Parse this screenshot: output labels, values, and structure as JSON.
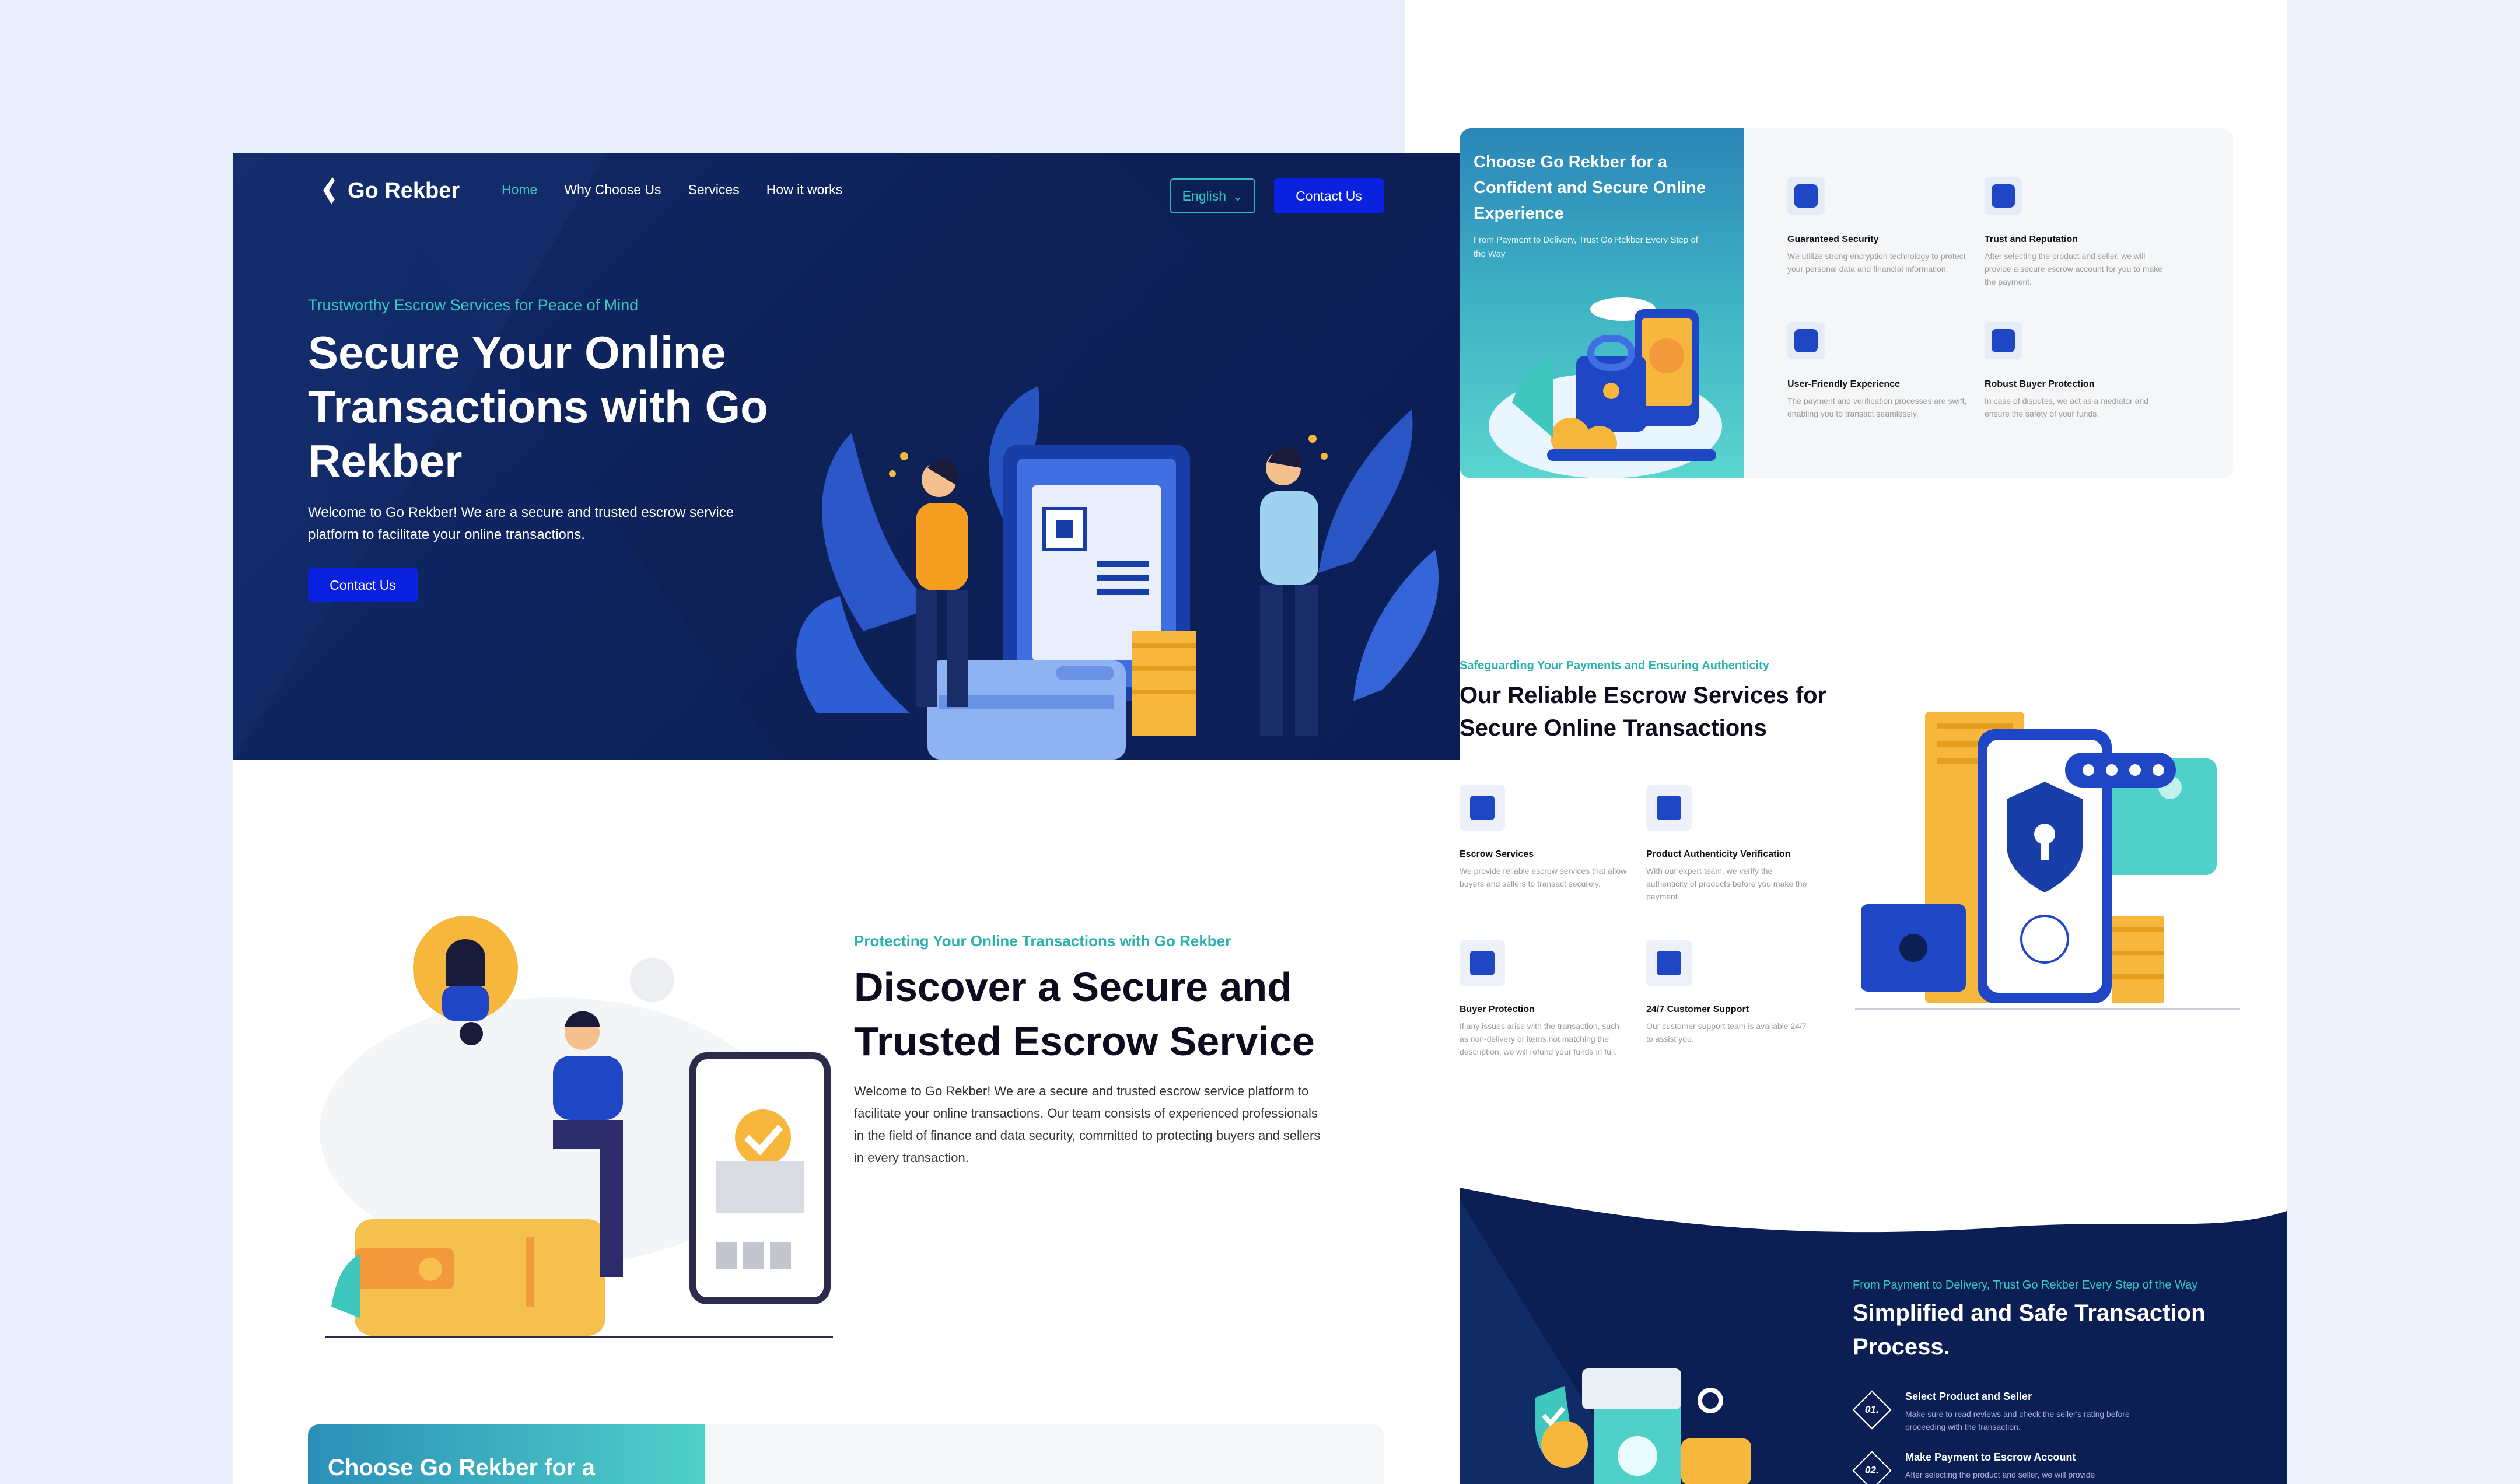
{
  "nav": {
    "brand": "Go Rekber",
    "links": [
      "Home",
      "Why Choose Us",
      "Services",
      "How it works"
    ],
    "language": "English",
    "contact": "Contact Us"
  },
  "hero": {
    "eyebrow": "Trustworthy Escrow Services for Peace of Mind",
    "title": "Secure Your Online Transactions with Go Rekber",
    "description": "Welcome to Go Rekber! We are a secure and trusted escrow service platform to facilitate your online transactions.",
    "cta": "Contact Us"
  },
  "discover": {
    "eyebrow": "Protecting Your Online Transactions with Go Rekber",
    "title": "Discover a Secure and Trusted Escrow Service",
    "description": "Welcome to Go Rekber! We are a secure and trusted escrow service platform to facilitate your online transactions. Our team consists of experienced professionals in the field of finance and data security, committed to protecting buyers and sellers in every transaction."
  },
  "choose_strip": {
    "title": "Choose Go Rekber for a"
  },
  "choose": {
    "title": "Choose Go Rekber for a Confident and Secure Online Experience",
    "subtitle": "From Payment to Delivery, Trust Go Rekber Every Step of the Way",
    "features": [
      {
        "title": "Guaranteed Security",
        "desc": "We utilize strong encryption technology to protect your personal data and financial information.",
        "icon": "shield-icon"
      },
      {
        "title": "Trust and Reputation",
        "desc": "After selecting the product and seller, we will provide a secure escrow account for you to make the payment.",
        "icon": "handshake-icon"
      },
      {
        "title": "User-Friendly Experience",
        "desc": "The payment and verification processes are swift, enabling you to transact seamlessly.",
        "icon": "smile-icon"
      },
      {
        "title": "Robust Buyer Protection",
        "desc": "In case of disputes, we act as a mediator and ensure the safety of your funds.",
        "icon": "buyer-protection-icon"
      }
    ]
  },
  "services": {
    "eyebrow": "Safeguarding Your Payments and Ensuring Authenticity",
    "title": "Our Reliable Escrow Services for Secure Online Transactions",
    "items": [
      {
        "title": "Escrow Services",
        "desc": "We provide reliable escrow services that allow buyers and sellers to transact securely.",
        "icon": "escrow-icon"
      },
      {
        "title": "Product Authenticity Verification",
        "desc": "With our expert team, we verify the authenticity of products before you make the payment.",
        "icon": "verification-icon"
      },
      {
        "title": "Buyer Protection",
        "desc": "If any issues arise with the transaction, such as non-delivery or items not matching the description, we will refund your funds in full.",
        "icon": "buyer-protection-icon"
      },
      {
        "title": "24/7 Customer Support",
        "desc": "Our customer support team is available 24/7 to assist you.",
        "icon": "support-icon"
      }
    ]
  },
  "process": {
    "eyebrow": "From Payment to Delivery, Trust Go Rekber Every Step of the Way",
    "title": "Simplified and Safe Transaction Process.",
    "steps": [
      {
        "num": "01.",
        "title": "Select Product and Seller",
        "desc": "Make sure to read reviews and check the seller's rating before proceeding with the transaction."
      },
      {
        "num": "02.",
        "title": "Make Payment to Escrow Account",
        "desc": "After selecting the product and seller, we will provide"
      }
    ]
  },
  "colors": {
    "navy": "#0e2258",
    "accent_teal": "#36c7c1",
    "button_blue": "#0a22e0",
    "orange": "#f6b73c"
  }
}
